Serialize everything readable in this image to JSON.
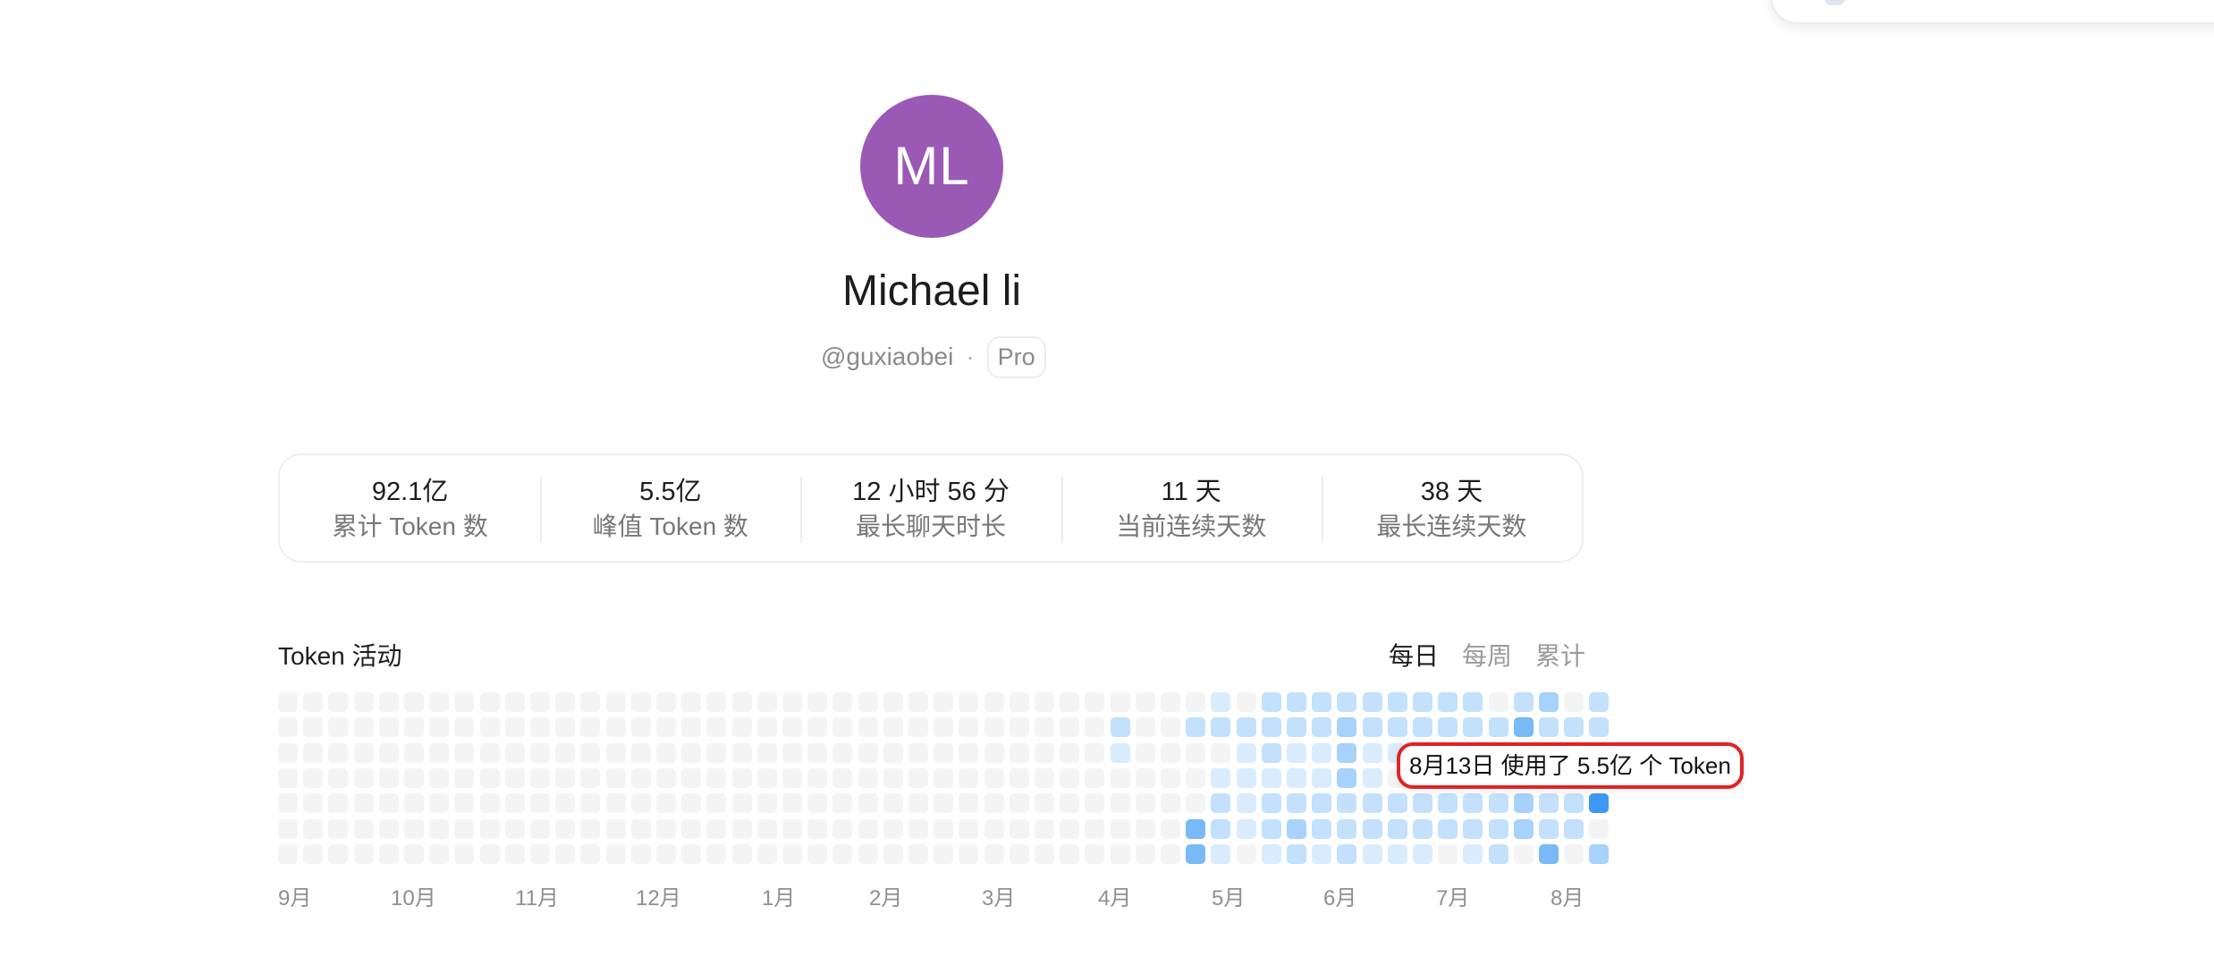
{
  "profile": {
    "avatar_initials": "ML",
    "avatar_color": "#9b59b6",
    "name": "Michael li",
    "handle": "@guxiaobei",
    "separator": "·",
    "plan_badge": "Pro"
  },
  "stats": [
    {
      "value": "92.1亿",
      "label": "累计 Token 数"
    },
    {
      "value": "5.5亿",
      "label": "峰值 Token 数"
    },
    {
      "value": "12 小时 56 分",
      "label": "最长聊天时长"
    },
    {
      "value": "11 天",
      "label": "当前连续天数"
    },
    {
      "value": "38 天",
      "label": "最长连续天数"
    }
  ],
  "activity": {
    "title": "Token 活动",
    "tabs": [
      {
        "label": "每日",
        "active": true
      },
      {
        "label": "每周",
        "active": false
      },
      {
        "label": "累计",
        "active": false
      }
    ],
    "months": [
      "9月",
      "10月",
      "11月",
      "12月",
      "1月",
      "2月",
      "3月",
      "4月",
      "5月",
      "6月",
      "7月",
      "8月"
    ],
    "tooltip": "8月13日 使用了 5.5亿 个 Token",
    "level_colors": [
      "#f4f4f4",
      "#d9ecfd",
      "#c3e0fc",
      "#a6d2fb",
      "#78b9f6",
      "#3d99f3"
    ],
    "weeks": [
      [
        0,
        0,
        0,
        0,
        0,
        0,
        0
      ],
      [
        0,
        0,
        0,
        0,
        0,
        0,
        0
      ],
      [
        0,
        0,
        0,
        0,
        0,
        0,
        0
      ],
      [
        0,
        0,
        0,
        0,
        0,
        0,
        0
      ],
      [
        0,
        0,
        0,
        0,
        0,
        0,
        0
      ],
      [
        0,
        0,
        0,
        0,
        0,
        0,
        0
      ],
      [
        0,
        0,
        0,
        0,
        0,
        0,
        0
      ],
      [
        0,
        0,
        0,
        0,
        0,
        0,
        0
      ],
      [
        0,
        0,
        0,
        0,
        0,
        0,
        0
      ],
      [
        0,
        0,
        0,
        0,
        0,
        0,
        0
      ],
      [
        0,
        0,
        0,
        0,
        0,
        0,
        0
      ],
      [
        0,
        0,
        0,
        0,
        0,
        0,
        0
      ],
      [
        0,
        0,
        0,
        0,
        0,
        0,
        0
      ],
      [
        0,
        0,
        0,
        0,
        0,
        0,
        0
      ],
      [
        0,
        0,
        0,
        0,
        0,
        0,
        0
      ],
      [
        0,
        0,
        0,
        0,
        0,
        0,
        0
      ],
      [
        0,
        0,
        0,
        0,
        0,
        0,
        0
      ],
      [
        0,
        0,
        0,
        0,
        0,
        0,
        0
      ],
      [
        0,
        0,
        0,
        0,
        0,
        0,
        0
      ],
      [
        0,
        0,
        0,
        0,
        0,
        0,
        0
      ],
      [
        0,
        0,
        0,
        0,
        0,
        0,
        0
      ],
      [
        0,
        0,
        0,
        0,
        0,
        0,
        0
      ],
      [
        0,
        0,
        0,
        0,
        0,
        0,
        0
      ],
      [
        0,
        0,
        0,
        0,
        0,
        0,
        0
      ],
      [
        0,
        0,
        0,
        0,
        0,
        0,
        0
      ],
      [
        0,
        0,
        0,
        0,
        0,
        0,
        0
      ],
      [
        0,
        0,
        0,
        0,
        0,
        0,
        0
      ],
      [
        0,
        0,
        0,
        0,
        0,
        0,
        0
      ],
      [
        0,
        0,
        0,
        0,
        0,
        0,
        0
      ],
      [
        0,
        0,
        0,
        0,
        0,
        0,
        0
      ],
      [
        0,
        0,
        0,
        0,
        0,
        0,
        0
      ],
      [
        0,
        0,
        0,
        0,
        0,
        0,
        0
      ],
      [
        0,
        0,
        0,
        0,
        0,
        0,
        0
      ],
      [
        0,
        2,
        1,
        0,
        0,
        0,
        0
      ],
      [
        0,
        0,
        0,
        0,
        0,
        0,
        0
      ],
      [
        0,
        0,
        0,
        0,
        0,
        0,
        0
      ],
      [
        0,
        2,
        0,
        0,
        0,
        4,
        4
      ],
      [
        1,
        2,
        0,
        1,
        2,
        2,
        1
      ],
      [
        0,
        2,
        1,
        1,
        1,
        1,
        0
      ],
      [
        2,
        2,
        2,
        1,
        2,
        2,
        1
      ],
      [
        2,
        2,
        1,
        1,
        2,
        3,
        2
      ],
      [
        2,
        2,
        1,
        1,
        2,
        2,
        1
      ],
      [
        2,
        3,
        3,
        3,
        2,
        2,
        2
      ],
      [
        2,
        2,
        1,
        1,
        2,
        2,
        1
      ],
      [
        2,
        2,
        1,
        0,
        2,
        2,
        1
      ],
      [
        2,
        2,
        0,
        0,
        2,
        2,
        1
      ],
      [
        2,
        2,
        0,
        0,
        2,
        2,
        0
      ],
      [
        2,
        2,
        0,
        0,
        2,
        2,
        1
      ],
      [
        0,
        2,
        0,
        0,
        2,
        2,
        2
      ],
      [
        2,
        4,
        0,
        0,
        3,
        3,
        0
      ],
      [
        3,
        2,
        0,
        0,
        2,
        2,
        4
      ],
      [
        0,
        2,
        0,
        0,
        2,
        2,
        0
      ],
      [
        2,
        2,
        0,
        0,
        5,
        0,
        3
      ]
    ]
  }
}
